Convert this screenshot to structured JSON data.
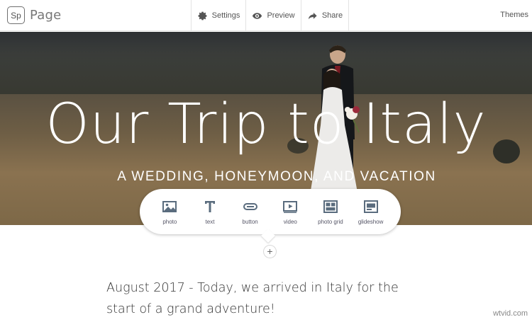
{
  "app": {
    "logo_text": "Sp",
    "name": "Page"
  },
  "toolbar": {
    "settings_label": "Settings",
    "preview_label": "Preview",
    "share_label": "Share",
    "themes_label": "Themes"
  },
  "hero": {
    "title": "Our Trip to Italy",
    "subtitle": "A WEDDING, HONEYMOON, AND VACATION"
  },
  "insert_palette": {
    "items": [
      {
        "label": "photo",
        "icon": "photo-icon"
      },
      {
        "label": "text",
        "icon": "text-icon"
      },
      {
        "label": "button",
        "icon": "button-icon"
      },
      {
        "label": "video",
        "icon": "video-icon"
      },
      {
        "label": "photo grid",
        "icon": "photo-grid-icon"
      },
      {
        "label": "glideshow",
        "icon": "glideshow-icon"
      }
    ],
    "add_symbol": "+"
  },
  "content": {
    "paragraph": "August 2017 - Today, we arrived in Italy for the start of a grand adventure!"
  },
  "watermark": "wtvid.com",
  "colors": {
    "icon": "#5a6c7e",
    "border": "#e3e3e3",
    "hero_text": "#ffffff"
  }
}
